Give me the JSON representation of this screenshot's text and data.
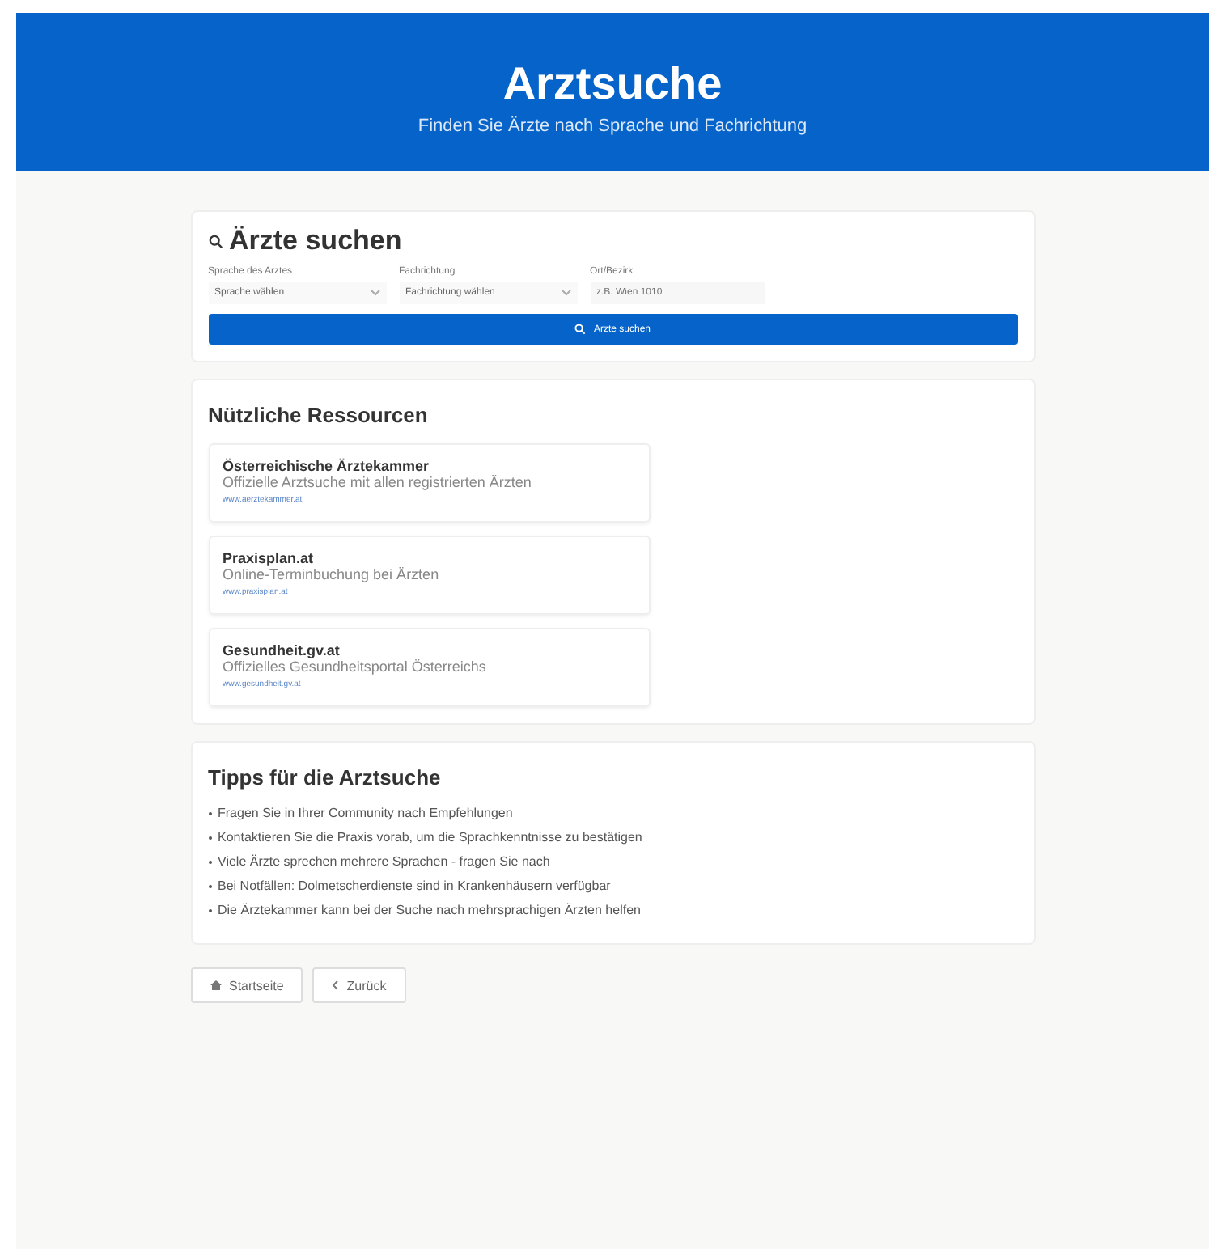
{
  "header": {
    "title": "Arztsuche",
    "subtitle": "Finden Sie Ärzte nach Sprache und Fachrichtung"
  },
  "search": {
    "title": "Ärzte suchen",
    "fields": [
      {
        "kind": "select",
        "label": "Sprache des Arztes",
        "value": "Sprache wählen"
      },
      {
        "kind": "select",
        "label": "Fachrichtung",
        "value": "Fachrichtung wählen"
      },
      {
        "kind": "input",
        "label": "Ort/Bezirk",
        "placeholder": "z.B. Wien 1010"
      }
    ],
    "button": "Ärzte suchen"
  },
  "resources": {
    "title": "Nützliche Ressourcen",
    "items": [
      {
        "name": "Österreichische Ärztekammer",
        "description": "Offizielle Arztsuche mit allen registrierten Ärzten",
        "link": "www.aerztekammer.at"
      },
      {
        "name": "Praxisplan.at",
        "description": "Online-Terminbuchung bei Ärzten",
        "link": "www.praxisplan.at"
      },
      {
        "name": "Gesundheit.gv.at",
        "description": "Offizielles Gesundheitsportal Österreichs",
        "link": "www.gesundheit.gv.at"
      }
    ]
  },
  "tips": {
    "title": "Tipps für die Arztsuche",
    "items": [
      "Fragen Sie in Ihrer Community nach Empfehlungen",
      "Kontaktieren Sie die Praxis vorab, um die Sprachkenntnisse zu bestätigen",
      "Viele Ärzte sprechen mehrere Sprachen - fragen Sie nach",
      "Bei Notfällen: Dolmetscherdienste sind in Krankenhäusern verfügbar",
      "Die Ärztekammer kann bei der Suche nach mehrsprachigen Ärzten helfen"
    ]
  },
  "nav": [
    {
      "kind": "home",
      "label": "Startseite"
    },
    {
      "kind": "back",
      "label": "Zurück"
    }
  ]
}
